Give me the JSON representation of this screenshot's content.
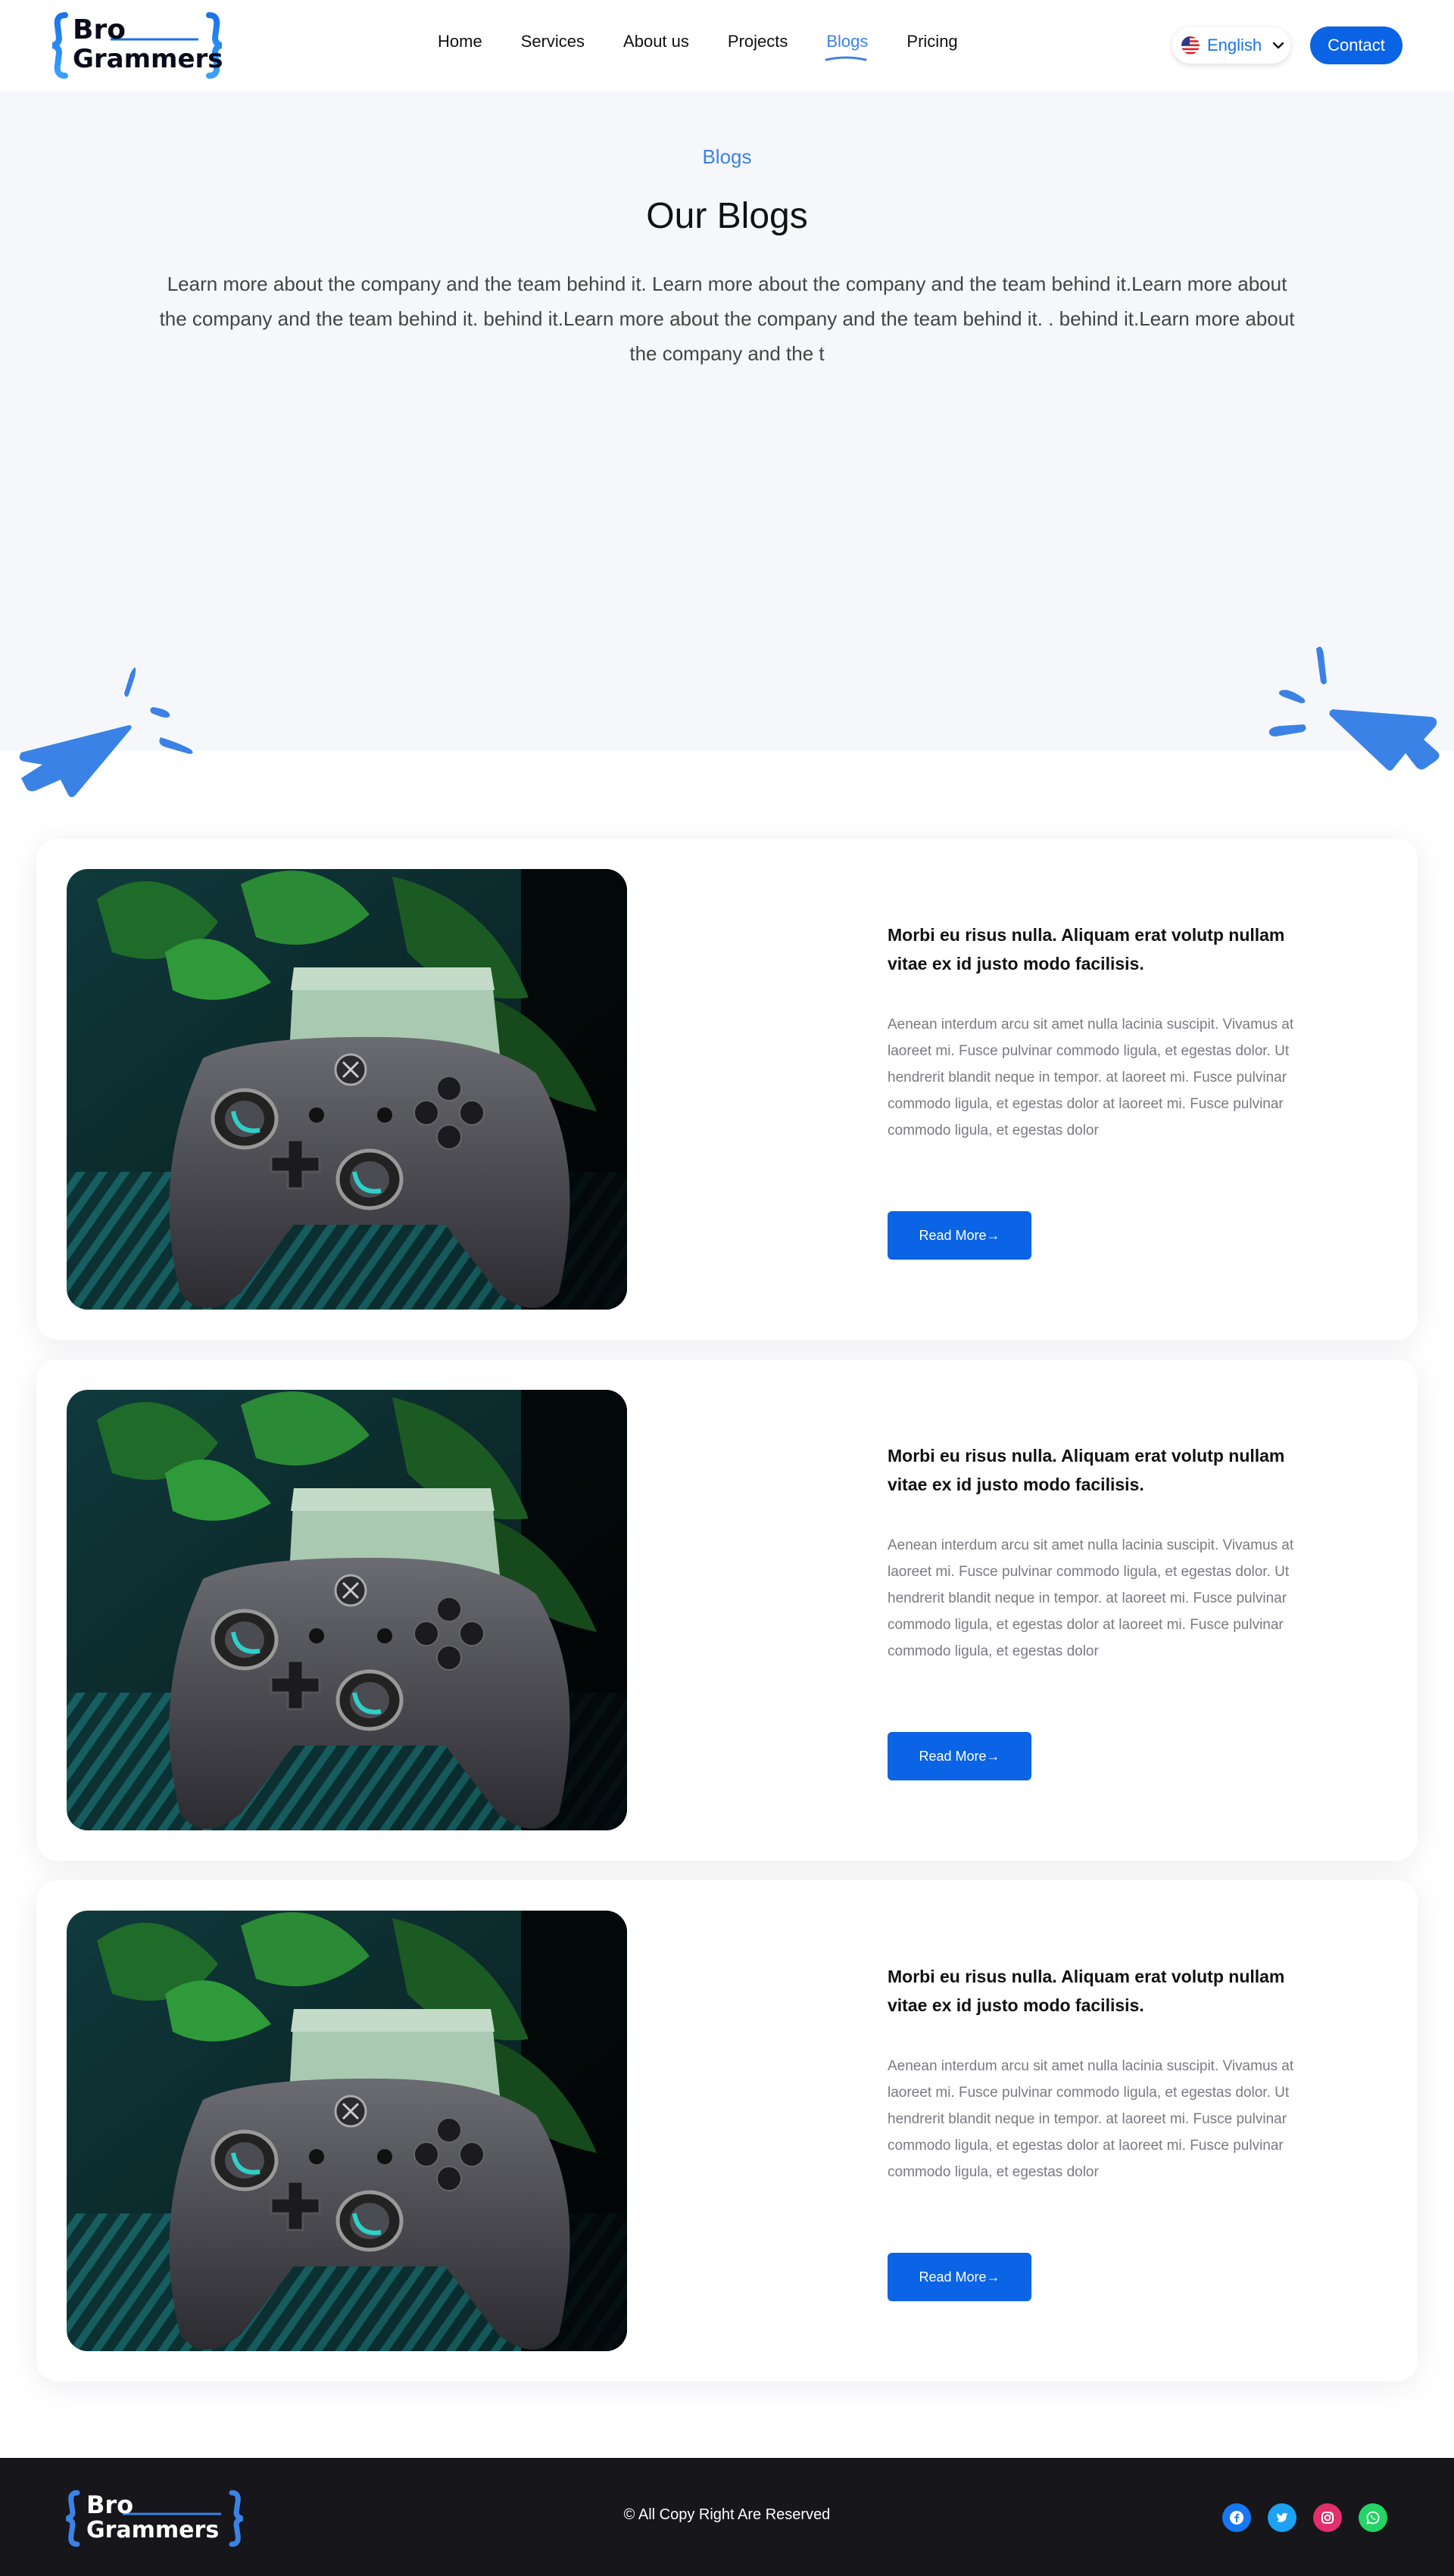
{
  "header": {
    "logo": {
      "line1": "Bro",
      "line2": "Grammers"
    },
    "nav": [
      {
        "label": "Home",
        "active": false
      },
      {
        "label": "Services",
        "active": false
      },
      {
        "label": "About us",
        "active": false
      },
      {
        "label": "Projects",
        "active": false
      },
      {
        "label": "Blogs",
        "active": true
      },
      {
        "label": "Pricing",
        "active": false
      }
    ],
    "language": {
      "label": "English",
      "flag": "us-flag-icon"
    },
    "contact_label": "Contact"
  },
  "hero": {
    "eyebrow": "Blogs",
    "title": "Our Blogs",
    "description": "Learn more about the company and the team behind it. Learn more about the company and the team behind it.Learn more about the company and the team behind it. behind it.Learn more about the company and the team behind it. . behind it.Learn more about the company and the t"
  },
  "blogs": [
    {
      "title": "Morbi eu risus nulla. Aliquam erat volutp nullam vitae ex id justo modo facilisis.",
      "body": "Aenean interdum arcu sit amet nulla lacinia suscipit. Vivamus at laoreet mi. Fusce pulvinar commodo ligula, et egestas dolor. Ut hendrerit blandit neque in tempor. at laoreet mi. Fusce pulvinar commodo ligula, et egestas dolor at laoreet mi. Fusce pulvinar commodo ligula, et egestas dolor",
      "read_more": "Read More→",
      "image": "game-controller-photo"
    },
    {
      "title": "Morbi eu risus nulla. Aliquam erat volutp nullam vitae ex id justo modo facilisis.",
      "body": "Aenean interdum arcu sit amet nulla lacinia suscipit. Vivamus at laoreet mi. Fusce pulvinar commodo ligula, et egestas dolor. Ut hendrerit blandit neque in tempor. at laoreet mi. Fusce pulvinar commodo ligula, et egestas dolor at laoreet mi. Fusce pulvinar commodo ligula, et egestas dolor",
      "read_more": "Read More→",
      "image": "game-controller-photo"
    },
    {
      "title": "Morbi eu risus nulla. Aliquam erat volutp nullam vitae ex id justo modo facilisis.",
      "body": "Aenean interdum arcu sit amet nulla lacinia suscipit. Vivamus at laoreet mi. Fusce pulvinar commodo ligula, et egestas dolor. Ut hendrerit blandit neque in tempor. at laoreet mi. Fusce pulvinar commodo ligula, et egestas dolor at laoreet mi. Fusce pulvinar commodo ligula, et egestas dolor",
      "read_more": "Read More→",
      "image": "game-controller-photo"
    }
  ],
  "footer": {
    "logo": {
      "line1": "Bro",
      "line2": "Grammers"
    },
    "copyright": "© All Copy Right Are Reserved",
    "socials": [
      {
        "name": "facebook-icon",
        "color": "#1877f2"
      },
      {
        "name": "twitter-icon",
        "color": "#1da1f2"
      },
      {
        "name": "instagram-icon",
        "color": "#e1306c"
      },
      {
        "name": "whatsapp-icon",
        "color": "#25d366"
      }
    ]
  },
  "colors": {
    "accent": "#0b63e5",
    "link_active": "#3b82e6",
    "hero_bg": "#f6f7fb",
    "footer_bg": "#16161b"
  }
}
